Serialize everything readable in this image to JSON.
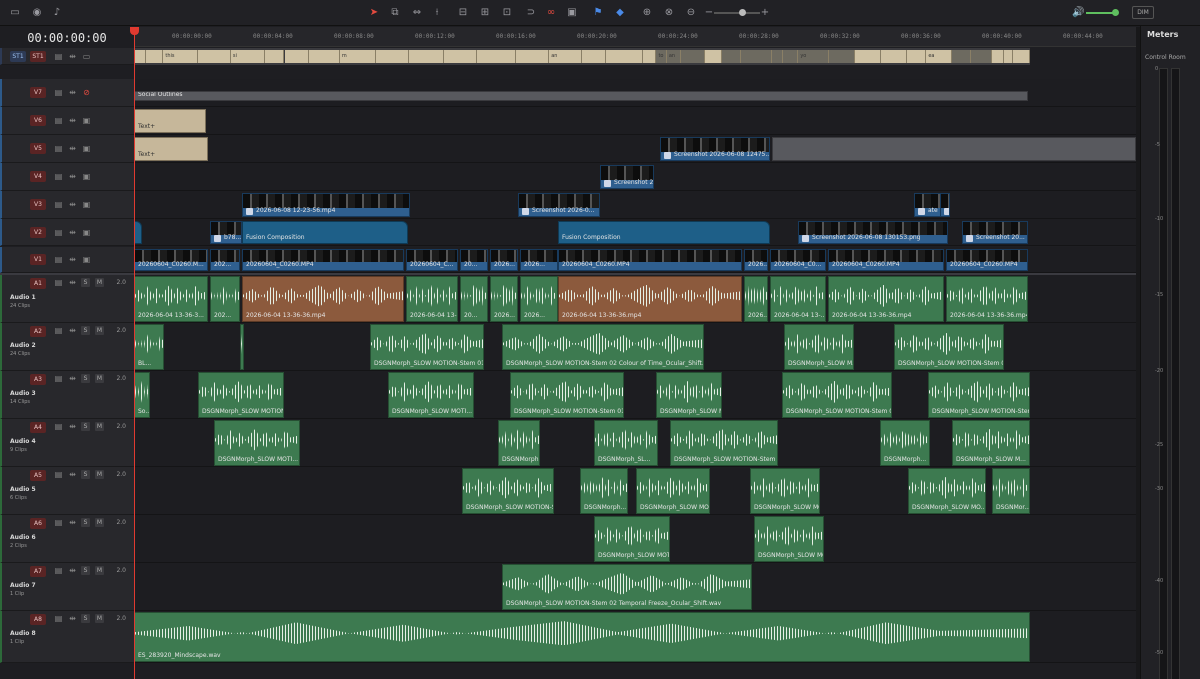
{
  "toolbar": {
    "icons": [
      "video-view-icon",
      "eye-icon",
      "mic-icon",
      "selection-tool-icon",
      "trim-tool-icon",
      "dynamic-trim-icon",
      "blade-tool-icon",
      "insert-clip-icon",
      "overwrite-clip-icon",
      "replace-clip-icon",
      "snapping-icon",
      "linked-selection-icon",
      "position-lock-icon",
      "flag-icon",
      "marker-icon",
      "zoom-full-icon",
      "zoom-detail-icon",
      "zoom-custom-icon",
      "zoom-out-icon",
      "zoom-in-icon",
      "speaker-icon"
    ],
    "dim_label": "DIM"
  },
  "timecode": "00:00:00:00",
  "ruler_ticks": [
    "00:00:00:00",
    "00:00:04:00",
    "00:00:08:00",
    "00:00:12:00",
    "00:00:16:00",
    "00:00:20:00",
    "00:00:24:00",
    "00:00:28:00",
    "00:00:32:00",
    "00:00:36:00",
    "00:00:40:00",
    "00:00:44:00"
  ],
  "subtitle_track": {
    "tags": [
      "ST1",
      "ST1"
    ],
    "words": [
      "this",
      "si",
      "m",
      "an",
      "to",
      "an",
      "yo",
      "ea",
      "for",
      "link"
    ]
  },
  "video_tracks": [
    {
      "id": "V7",
      "clips": [
        "Social Outlines"
      ]
    },
    {
      "id": "V6",
      "clips": [
        "Text+"
      ]
    },
    {
      "id": "V5",
      "clips": [
        "Text+",
        "Screenshot 2026-06-08 12475..."
      ]
    },
    {
      "id": "V4",
      "clips": [
        "Screenshot 2..."
      ]
    },
    {
      "id": "V3",
      "clips": [
        "2026-06-08 12-23-56.mp4",
        "Screenshot 2026-0...",
        "ate your fin",
        "Scree..."
      ]
    },
    {
      "id": "V2",
      "clips": [
        "b78...",
        "Fusion Composition",
        "Fusion Composition",
        "Screenshot 2026-06-08 130153.png",
        "Screenshot 20..."
      ]
    },
    {
      "id": "V1",
      "clips": [
        "20260604_C0260.M...",
        "202...",
        "20260604_C0260.MP4",
        "20260604_C...",
        "20...",
        "2026...",
        "2026...",
        "20260604_C0260.MP4",
        "2026...",
        "20260604_C0...",
        "20260604_C0260.MP4",
        "20260604_C0260.MP4"
      ]
    }
  ],
  "audio_tracks": [
    {
      "id": "A1",
      "name": "Audio 1",
      "count": "24 Clips",
      "vol": "2.0",
      "clips": [
        "2026-06-04 13-36-3...",
        "202...",
        "2026-06-04 13-36-36.mp4",
        "2026-06-04 13-3...",
        "20...",
        "2026...",
        "2026...",
        "2026-06-04 13-36-36.mp4",
        "2026...",
        "2026-06-04 13-...",
        "2026-06-04 13-36-36.mp4",
        "2026-06-04 13-36-36.mp4"
      ]
    },
    {
      "id": "A2",
      "name": "Audio 2",
      "count": "24 Clips",
      "vol": "2.0",
      "clips": [
        "BL...",
        "DSGNMorph_SLOW MOTION-Stem 01 ...",
        "DSGNMorph_SLOW MOTION-Stem 02 Colour of Time_Ocular_Shift.wav",
        "DSGNMorph_SLOW M...",
        "DSGNMorph_SLOW MOTION-Stem 01 ..."
      ]
    },
    {
      "id": "A3",
      "name": "Audio 3",
      "count": "14 Clips",
      "vol": "2.0",
      "clips": [
        "So...",
        "DSGNMorph_SLOW MOTION...",
        "DSGNMorph_SLOW MOTI...",
        "DSGNMorph_SLOW MOTION-Stem 01 C...",
        "DSGNMorph_SLOW MOTI...",
        "DSGNMorph_SLOW MOTION-Stem 02",
        "DSGNMorph_SLOW MOTION-Stem"
      ]
    },
    {
      "id": "A4",
      "name": "Audio 4",
      "count": "9 Clips",
      "vol": "2.0",
      "clips": [
        "DSGNMorph_SLOW MOTI...",
        "DSGNMorph...",
        "DSGNMorph_SL...",
        "DSGNMorph_SLOW MOTION-Stem 0...",
        "DSGNMorph...",
        "DSGNMorph_SLOW M..."
      ]
    },
    {
      "id": "A5",
      "name": "Audio 5",
      "count": "6 Clips",
      "vol": "2.0",
      "clips": [
        "DSGNMorph_SLOW MOTION-St...",
        "DSGNMorph...",
        "DSGNMorph_SLOW MO...",
        "DSGNMorph_SLOW MOTI...",
        "DSGNMorph_SLOW MO...",
        "DSGNMor..."
      ]
    },
    {
      "id": "A6",
      "name": "Audio 6",
      "count": "2 Clips",
      "vol": "2.0",
      "clips": [
        "DSGNMorph_SLOW MOTI...",
        "DSGNMorph_SLOW MOT..."
      ]
    },
    {
      "id": "A7",
      "name": "Audio 7",
      "count": "1 Clip",
      "vol": "2.0",
      "clips": [
        "DSGNMorph_SLOW MOTION-Stem 02 Temporal Freeze_Ocular_Shift.wav"
      ]
    },
    {
      "id": "A8",
      "name": "Audio 8",
      "count": "1 Clip",
      "vol": "2.0",
      "clips": [
        "ES_283920_Mindscape.wav"
      ]
    }
  ],
  "meters": {
    "title": "Meters",
    "room": "Control Room",
    "scale": [
      "0",
      "-5",
      "-10",
      "-15",
      "-20",
      "-25",
      "-30",
      "-40",
      "-50"
    ]
  }
}
